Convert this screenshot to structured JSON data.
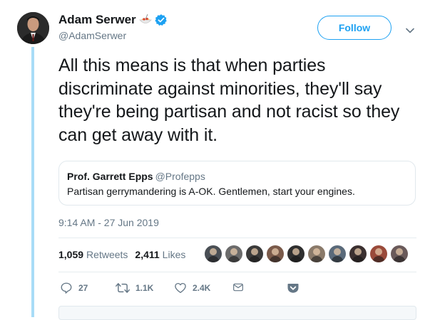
{
  "author": {
    "display_name": "Adam Serwer",
    "handle": "@AdamSerwer",
    "emoji_icon": "pasta-bowl-icon",
    "verified_icon": "verified-badge-icon"
  },
  "follow_label": "Follow",
  "tweet": {
    "text": "All this means is that when parties discriminate against minorities, they'll say they're being partisan and not racist so they can get away with it."
  },
  "quoted_tweet": {
    "author_name": "Prof. Garrett Epps",
    "author_handle": "@Profepps",
    "text": "Partisan gerrymandering is A-OK. Gentlemen, start your engines."
  },
  "timestamp": "9:14 AM - 27 Jun 2019",
  "stats": {
    "retweets_count": "1,059",
    "retweets_label": "Retweets",
    "likes_count": "2,411",
    "likes_label": "Likes"
  },
  "liker_avatars": [
    "#4a4f55",
    "#6b6b6b",
    "#3a3a3a",
    "#7a5a4a",
    "#2f2f2f",
    "#8a7a6a",
    "#5a6a7a",
    "#3b3030",
    "#9a4a3a",
    "#6a5a5a"
  ],
  "actions": {
    "replies": "27",
    "retweets": "1.1K",
    "likes": "2.4K"
  },
  "colors": {
    "accent": "#1da1f2",
    "secondary_text": "#657786",
    "thread_line": "#a8dcf7"
  }
}
